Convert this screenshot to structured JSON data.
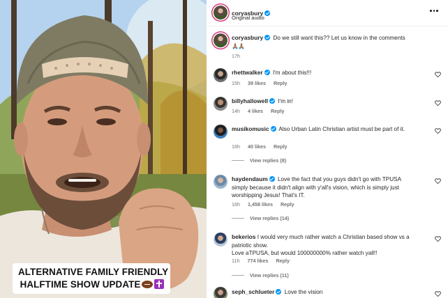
{
  "video": {
    "caption_line1": "ALTERNATIVE FAMILY FRIENDLY",
    "caption_line2": "HALFTIME SHOW UPDATE"
  },
  "header": {
    "username": "coryasbury",
    "audio": "Original audio"
  },
  "caption_comment": {
    "username": "coryasbury",
    "text": "Do we still want this?? Let us know in the comments",
    "emoji": "🙏🏽🙏🏽",
    "time": "17h"
  },
  "comments": [
    {
      "username": "rhettwalker",
      "text": "I'm about this!!!",
      "time": "15h",
      "likes": "39 likes",
      "reply": "Reply"
    },
    {
      "username": "billyhallowell",
      "text": "I'm in!",
      "time": "14h",
      "likes": "4 likes",
      "reply": "Reply"
    },
    {
      "username": "musikomusic",
      "text": "Also Urban Latin Christian artist must be part of it.",
      "time": "16h",
      "likes": "40 likes",
      "reply": "Reply",
      "view_replies": "View replies (8)"
    },
    {
      "username": "haydendaum",
      "text": "Love the fact that you guys didn't go with TPUSA simply because it didn't align with y'all's vision, which is simply just worshipping Jesus! That's IT.",
      "time": "16h",
      "likes": "1,458 likes",
      "reply": "Reply",
      "view_replies": "View replies (14)"
    },
    {
      "username": "bekerios",
      "text": "I would very much rather watch a Christian based show vs a patriotic show.",
      "text2": "Love aTPUSA, but would 100000000% rather watch yall!!",
      "time": "11h",
      "likes": "774 likes",
      "reply": "Reply",
      "view_replies": "View replies (11)"
    },
    {
      "username": "seph_schlueter",
      "text": "Love the vision"
    }
  ],
  "colors": {
    "verified": "#0095f6",
    "muted": "#737373",
    "ring": "#d62976"
  },
  "icons": [
    "more-horizontal-icon",
    "verified-badge-icon",
    "heart-icon",
    "football-emoji",
    "cross-emoji"
  ]
}
